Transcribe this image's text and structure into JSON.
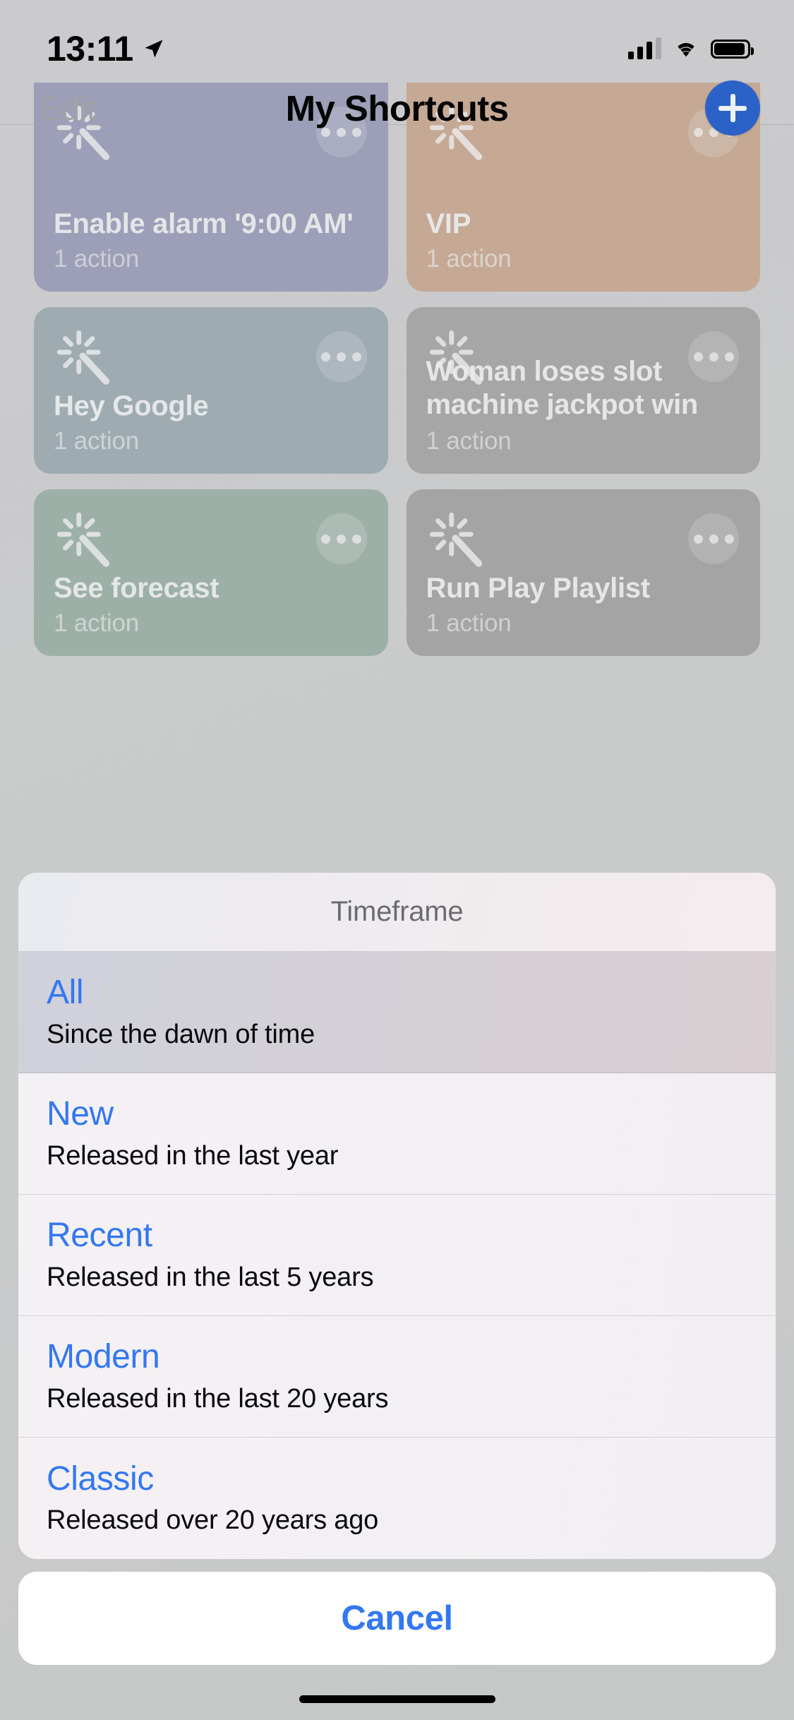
{
  "status_bar": {
    "time": "13:11",
    "location_icon": "location-arrow-icon",
    "cellular_icon": "cellular-signal-icon",
    "wifi_icon": "wifi-icon",
    "battery_icon": "battery-full-icon"
  },
  "nav_bar": {
    "left_button": "Edit",
    "title": "My Shortcuts",
    "right_button_icon": "plus-icon",
    "accent_color": "#2b62c7"
  },
  "shortcuts": [
    {
      "title": "Enable alarm '9:00 AM'",
      "subtitle": "1 action",
      "color": "#8e92b4",
      "icon": "magic-wand-icon",
      "menu_icon": "ellipsis-icon"
    },
    {
      "title": "VIP",
      "subtitle": "1 action",
      "color": "#c9a183",
      "icon": "magic-wand-icon",
      "menu_icon": "ellipsis-icon"
    },
    {
      "title": "Hey Google",
      "subtitle": "1 action",
      "color": "#91a5ad",
      "icon": "magic-wand-icon",
      "menu_icon": "ellipsis-icon"
    },
    {
      "title": "Woman loses slot machine jackpot win a…",
      "subtitle": "1 action",
      "color": "#9d9d9b",
      "icon": "magic-wand-icon",
      "menu_icon": "ellipsis-icon"
    },
    {
      "title": "See forecast",
      "subtitle": "1 action",
      "color": "#8fab9c",
      "icon": "magic-wand-icon",
      "menu_icon": "ellipsis-icon"
    },
    {
      "title": "Run Play Playlist",
      "subtitle": "1 action",
      "color": "#9a9a98",
      "icon": "magic-wand-icon",
      "menu_icon": "ellipsis-icon"
    }
  ],
  "action_sheet": {
    "title": "Timeframe",
    "accent_color": "#3478f0",
    "options": [
      {
        "title": "All",
        "subtitle": "Since the dawn of time",
        "highlighted": true
      },
      {
        "title": "New",
        "subtitle": "Released in the last year",
        "highlighted": false
      },
      {
        "title": "Recent",
        "subtitle": "Released in the last 5 years",
        "highlighted": false
      },
      {
        "title": "Modern",
        "subtitle": "Released in the last 20 years",
        "highlighted": false
      },
      {
        "title": "Classic",
        "subtitle": "Released over 20 years ago",
        "highlighted": false
      }
    ],
    "cancel_label": "Cancel"
  }
}
